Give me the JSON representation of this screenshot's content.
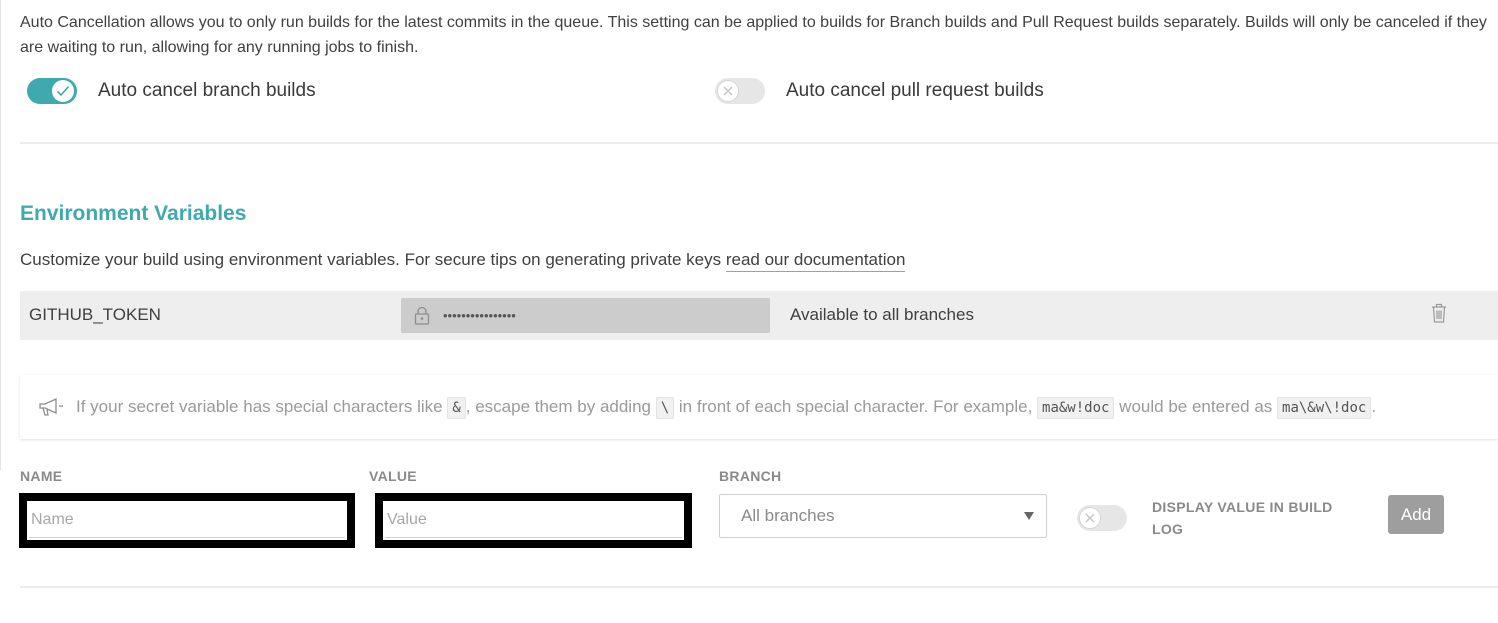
{
  "auto_cancellation": {
    "description": "Auto Cancellation allows you to only run builds for the latest commits in the queue. This setting can be applied to builds for Branch builds and Pull Request builds separately. Builds will only be canceled if they are waiting to run, allowing for any running jobs to finish.",
    "branch_toggle": {
      "label": "Auto cancel branch builds",
      "enabled": true
    },
    "pr_toggle": {
      "label": "Auto cancel pull request builds",
      "enabled": false
    }
  },
  "env_section": {
    "title": "Environment Variables",
    "description": "Customize your build using environment variables. For secure tips on generating private keys ",
    "doc_link": "read our documentation",
    "variables": [
      {
        "name": "GITHUB_TOKEN",
        "masked_value": "••••••••••••••••",
        "branch": "Available to all branches"
      }
    ]
  },
  "notice": {
    "part1": "If your secret variable has special characters like ",
    "code1": "&",
    "part2": ", escape them by adding ",
    "code2": "\\",
    "part3": " in front of each special character. For example, ",
    "code3": "ma&w!doc",
    "part4": " would be entered as ",
    "code4": "ma\\&w\\!doc",
    "part5": "."
  },
  "form": {
    "name_label": "NAME",
    "name_placeholder": "Name",
    "value_label": "VALUE",
    "value_placeholder": "Value",
    "branch_label": "BRANCH",
    "branch_selected": "All branches",
    "display_label": "DISPLAY VALUE IN BUILD LOG",
    "display_enabled": false,
    "add_label": "Add"
  },
  "colors": {
    "accent": "#3eaaaf",
    "row_bg": "#eeeeee",
    "button_bg": "#9e9e9e"
  },
  "icons": [
    "check-icon",
    "x-icon",
    "lock-icon",
    "trash-icon",
    "megaphone-icon",
    "dropdown-arrow-icon"
  ]
}
